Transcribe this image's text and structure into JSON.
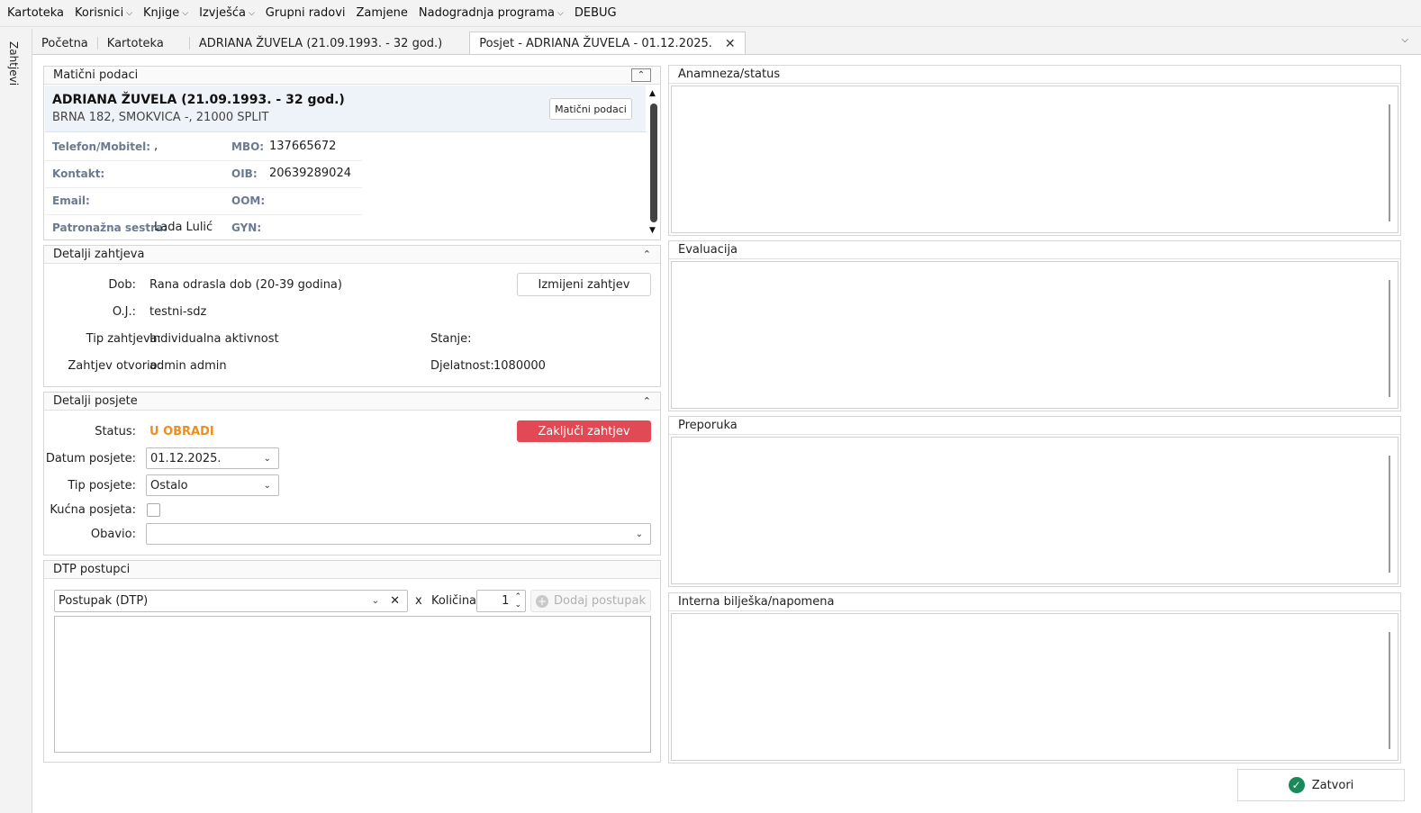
{
  "menu": [
    {
      "label": "Kartoteka",
      "caret": false
    },
    {
      "label": "Korisnici",
      "caret": true
    },
    {
      "label": "Knjige",
      "caret": true
    },
    {
      "label": "Izvješća",
      "caret": true
    },
    {
      "label": "Grupni radovi",
      "caret": false
    },
    {
      "label": "Zamjene",
      "caret": false
    },
    {
      "label": "Nadogradnja programa",
      "caret": true
    },
    {
      "label": "DEBUG",
      "caret": false
    }
  ],
  "leftbar": {
    "vertical_tab": "Zahtjevi"
  },
  "tabs": {
    "t1": "Početna",
    "t2": "Kartoteka",
    "t3": "ADRIANA ŽUVELA (21.09.1993. - 32 god.)",
    "t4": "Posjet - ADRIANA ŽUVELA - 01.12.2025."
  },
  "maticni": {
    "header": "Matični podaci",
    "name": "ADRIANA ŽUVELA (21.09.1993. - 32 god.)",
    "address": "BRNA 182, SMOKVICA -, 21000 SPLIT",
    "button": "Matični podaci",
    "telefon_label": "Telefon/Mobitel:",
    "telefon_value": ",",
    "kontakt_label": "Kontakt:",
    "kontakt_value": "",
    "email_label": "Email:",
    "email_value": "",
    "sestra_label": "Patronažna sestra:",
    "sestra_value": "Lada Lulić",
    "mbo_label": "MBO:",
    "mbo_value": "137665672",
    "oib_label": "OIB:",
    "oib_value": "20639289024",
    "oom_label": "OOM:",
    "oom_value": "",
    "gyn_label": "GYN:",
    "gyn_value": ""
  },
  "zahtjev": {
    "header": "Detalji zahtjeva",
    "dob_label": "Dob:",
    "dob_value": "Rana odrasla dob (20-39 godina)",
    "oj_label": "O.J.:",
    "oj_value": "testni-sdz",
    "tip_label": "Tip zahtjeva:",
    "tip_value": "Individualna aktivnost",
    "otvorio_label": "Zahtjev otvorio:",
    "otvorio_value": "admin admin",
    "stanje_label": "Stanje:",
    "stanje_value": "",
    "djelatnost_label": "Djelatnost:",
    "djelatnost_value": "1080000",
    "button": "Izmijeni zahtjev"
  },
  "posjet": {
    "header": "Detalji posjete",
    "status_label": "Status:",
    "status_value": "U OBRADI",
    "datum_label": "Datum posjete:",
    "datum_value": "01.12.2025.",
    "tip_label": "Tip posjete:",
    "tip_value": "Ostalo",
    "kucna_label": "Kućna posjeta:",
    "obavio_label": "Obavio:",
    "obavio_value": "",
    "button": "Zaključi zahtjev",
    "status_color": "#f08c1a",
    "button_color": "#e14a55"
  },
  "dtp": {
    "header": "DTP postupci",
    "postupak_placeholder": "Postupak (DTP)",
    "x": "x",
    "kolicina_label": "Količina",
    "kolicina_value": "1",
    "add_button": "Dodaj postupak"
  },
  "right_panels": {
    "anamneza": "Anamneza/status",
    "evaluacija": "Evaluacija",
    "preporuka": "Preporuka",
    "interna": "Interna bilješka/napomena"
  },
  "footer": {
    "close_button": "Zatvori",
    "icon": "check-circle-icon"
  }
}
